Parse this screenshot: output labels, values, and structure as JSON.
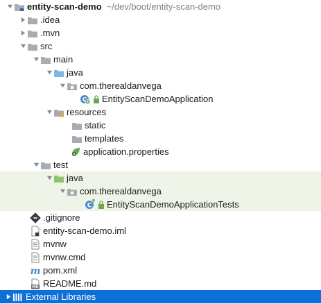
{
  "project": {
    "name": "entity-scan-demo",
    "path": "~/dev/boot/entity-scan-demo"
  },
  "tree": {
    "idea": ".idea",
    "mvn": ".mvn",
    "src": "src",
    "main": "main",
    "main_java": "java",
    "main_package": "com.therealdanvega",
    "main_class": "EntityScanDemoApplication",
    "resources": "resources",
    "static": "static",
    "templates": "templates",
    "app_props": "application.properties",
    "test": "test",
    "test_java": "java",
    "test_package": "com.therealdanvega",
    "test_class": "EntityScanDemoApplicationTests",
    "gitignore": ".gitignore",
    "iml": "entity-scan-demo.iml",
    "mvnw": "mvnw",
    "mvnw_cmd": "mvnw.cmd",
    "pom": "pom.xml",
    "readme": "README.md",
    "external_libraries": "External Libraries"
  },
  "colors": {
    "folder": "#a8adb3",
    "source_folder": "#79b8e8",
    "test_folder": "#8cc56d",
    "test_row_bg": "#eef5e8",
    "selection": "#0f6fd8"
  }
}
